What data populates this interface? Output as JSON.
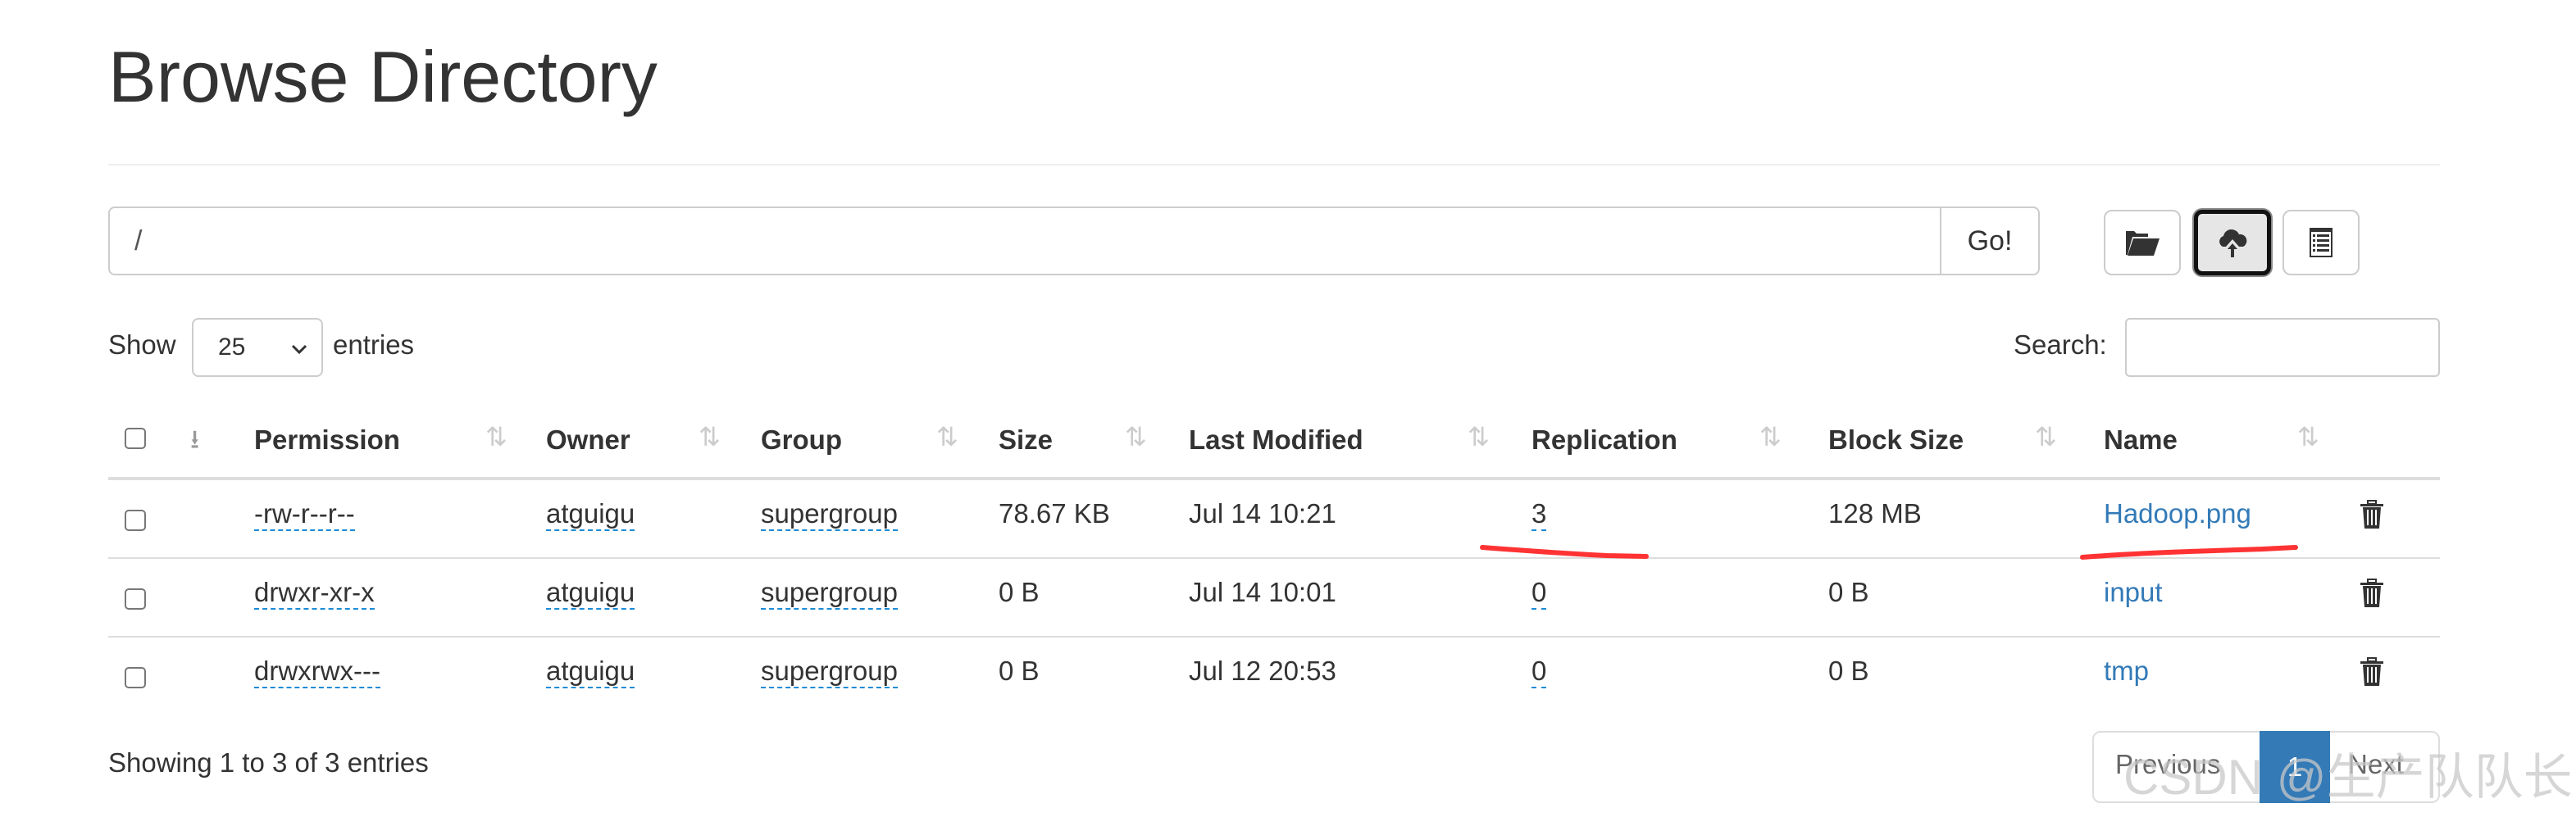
{
  "page": {
    "title": "Browse Directory"
  },
  "toolbar": {
    "path_value": "/",
    "go_label": "Go!",
    "icons": [
      "folder-open-icon",
      "cloud-upload-icon",
      "list-icon"
    ]
  },
  "controls": {
    "show_label": "Show",
    "entries_value": "25",
    "entries_label": "entries",
    "search_label": "Search:",
    "search_value": ""
  },
  "table": {
    "columns": [
      "Permission",
      "Owner",
      "Group",
      "Size",
      "Last Modified",
      "Replication",
      "Block Size",
      "Name"
    ],
    "rows": [
      {
        "permission": "-rw-r--r--",
        "owner": "atguigu",
        "group": "supergroup",
        "size": "78.67 KB",
        "modified": "Jul 14 10:21",
        "replication": "3",
        "block_size": "128 MB",
        "name": "Hadoop.png"
      },
      {
        "permission": "drwxr-xr-x",
        "owner": "atguigu",
        "group": "supergroup",
        "size": "0 B",
        "modified": "Jul 14 10:01",
        "replication": "0",
        "block_size": "0 B",
        "name": "input"
      },
      {
        "permission": "drwxrwx---",
        "owner": "atguigu",
        "group": "supergroup",
        "size": "0 B",
        "modified": "Jul 12 20:53",
        "replication": "0",
        "block_size": "0 B",
        "name": "tmp"
      }
    ]
  },
  "footer": {
    "info": "Showing 1 to 3 of 3 entries",
    "previous": "Previous",
    "page": "1",
    "next": "Next"
  },
  "watermark": "CSDN @生产队队长",
  "colors": {
    "link": "#337ab7",
    "active_page": "#337ab7",
    "annotation": "#ff3333"
  }
}
